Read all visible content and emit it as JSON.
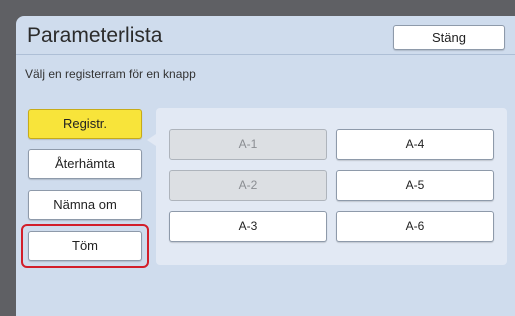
{
  "window": {
    "title": "Parameterlista",
    "close_label": "Stäng",
    "instruction": "Välj en registerram för en knapp"
  },
  "side_buttons": [
    {
      "label": "Registr.",
      "active": true
    },
    {
      "label": "Återhämta",
      "active": false
    },
    {
      "label": "Nämna om",
      "active": false
    },
    {
      "label": "Töm",
      "active": false,
      "highlighted": true
    }
  ],
  "slots": [
    {
      "label": "A-1",
      "enabled": false
    },
    {
      "label": "A-2",
      "enabled": false
    },
    {
      "label": "A-3",
      "enabled": true
    },
    {
      "label": "A-4",
      "enabled": true
    },
    {
      "label": "A-5",
      "enabled": true
    },
    {
      "label": "A-6",
      "enabled": true
    }
  ],
  "colors": {
    "active_button": "#f8e43a",
    "highlight_border": "#d21e2a",
    "window_background": "#cfdced"
  }
}
